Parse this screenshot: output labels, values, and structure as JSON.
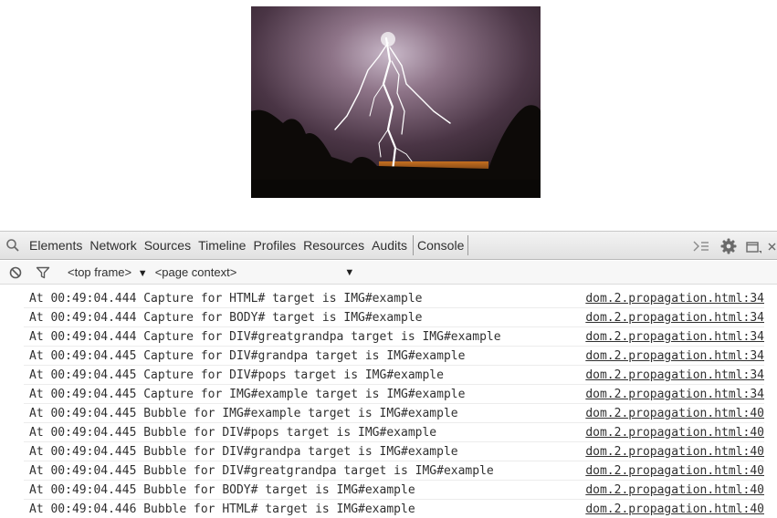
{
  "photo": {
    "alt": ""
  },
  "toolbar": {
    "tabs": [
      {
        "label": "Elements"
      },
      {
        "label": "Network"
      },
      {
        "label": "Sources"
      },
      {
        "label": "Timeline"
      },
      {
        "label": "Profiles"
      },
      {
        "label": "Resources"
      },
      {
        "label": "Audits"
      },
      {
        "label": "Console",
        "active": true
      }
    ]
  },
  "filterbar": {
    "frame": "<top frame>",
    "context": "<page context>"
  },
  "console": {
    "rows": [
      {
        "message": "At 00:49:04.444 Capture for HTML# target is IMG#example",
        "source": "dom.2.propagation.html:34"
      },
      {
        "message": "At 00:49:04.444 Capture for BODY# target is IMG#example",
        "source": "dom.2.propagation.html:34"
      },
      {
        "message": "At 00:49:04.444 Capture for DIV#greatgrandpa target is IMG#example",
        "source": "dom.2.propagation.html:34"
      },
      {
        "message": "At 00:49:04.445 Capture for DIV#grandpa target is IMG#example",
        "source": "dom.2.propagation.html:34"
      },
      {
        "message": "At 00:49:04.445 Capture for DIV#pops target is IMG#example",
        "source": "dom.2.propagation.html:34"
      },
      {
        "message": "At 00:49:04.445 Capture for IMG#example target is IMG#example",
        "source": "dom.2.propagation.html:34"
      },
      {
        "message": "At 00:49:04.445 Bubble for IMG#example target is IMG#example",
        "source": "dom.2.propagation.html:40"
      },
      {
        "message": "At 00:49:04.445 Bubble for DIV#pops target is IMG#example",
        "source": "dom.2.propagation.html:40"
      },
      {
        "message": "At 00:49:04.445 Bubble for DIV#grandpa target is IMG#example",
        "source": "dom.2.propagation.html:40"
      },
      {
        "message": "At 00:49:04.445 Bubble for DIV#greatgrandpa target is IMG#example",
        "source": "dom.2.propagation.html:40"
      },
      {
        "message": "At 00:49:04.445 Bubble for BODY# target is IMG#example",
        "source": "dom.2.propagation.html:40"
      },
      {
        "message": "At 00:49:04.446 Bubble for HTML# target is IMG#example",
        "source": "dom.2.propagation.html:40"
      }
    ]
  }
}
